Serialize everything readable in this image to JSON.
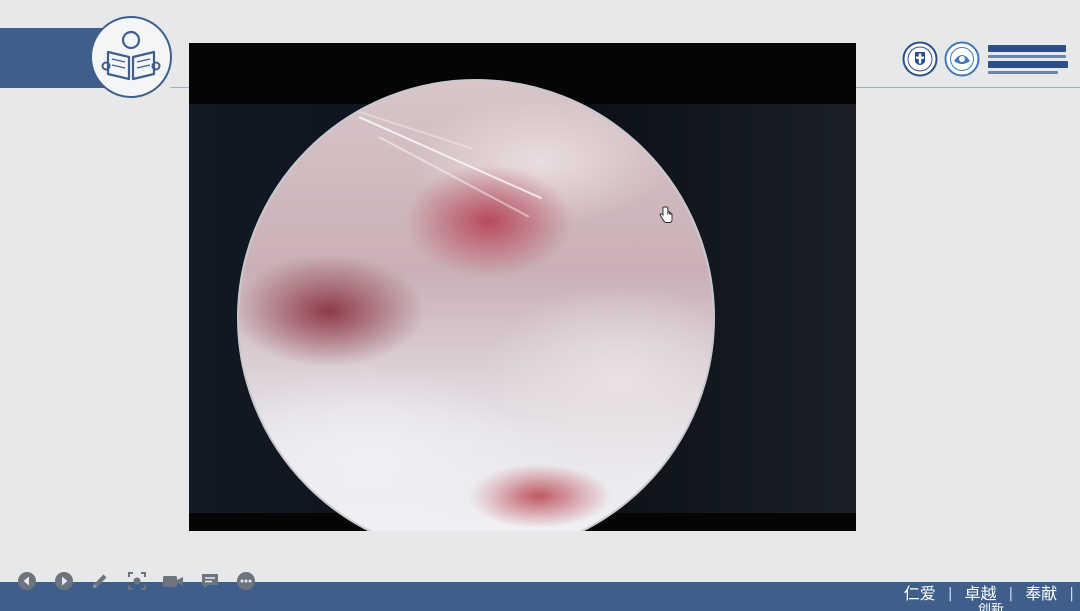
{
  "colors": {
    "brand_blue": "#3f5f8a",
    "background": "#e7e8ea",
    "video_letterbox": "#050505"
  },
  "header": {
    "reader_logo_icon": "reading-book-icon",
    "hospital_logos": [
      "hospital-seal-icon",
      "university-seal-icon",
      "hospital-name-logo"
    ]
  },
  "video": {
    "content": "arthroscopic-view",
    "cursor_icon": "hand-pointer-icon"
  },
  "toolbar": {
    "items": [
      {
        "icon": "previous-icon"
      },
      {
        "icon": "next-icon"
      },
      {
        "icon": "pen-icon"
      },
      {
        "icon": "focus-icon"
      },
      {
        "icon": "camera-icon"
      },
      {
        "icon": "subtitle-icon"
      },
      {
        "icon": "more-icon"
      }
    ]
  },
  "footer": {
    "motto": [
      "仁爱",
      "卓越",
      "奉献"
    ],
    "motto_separator": "|",
    "motto_overflow": "创新"
  }
}
